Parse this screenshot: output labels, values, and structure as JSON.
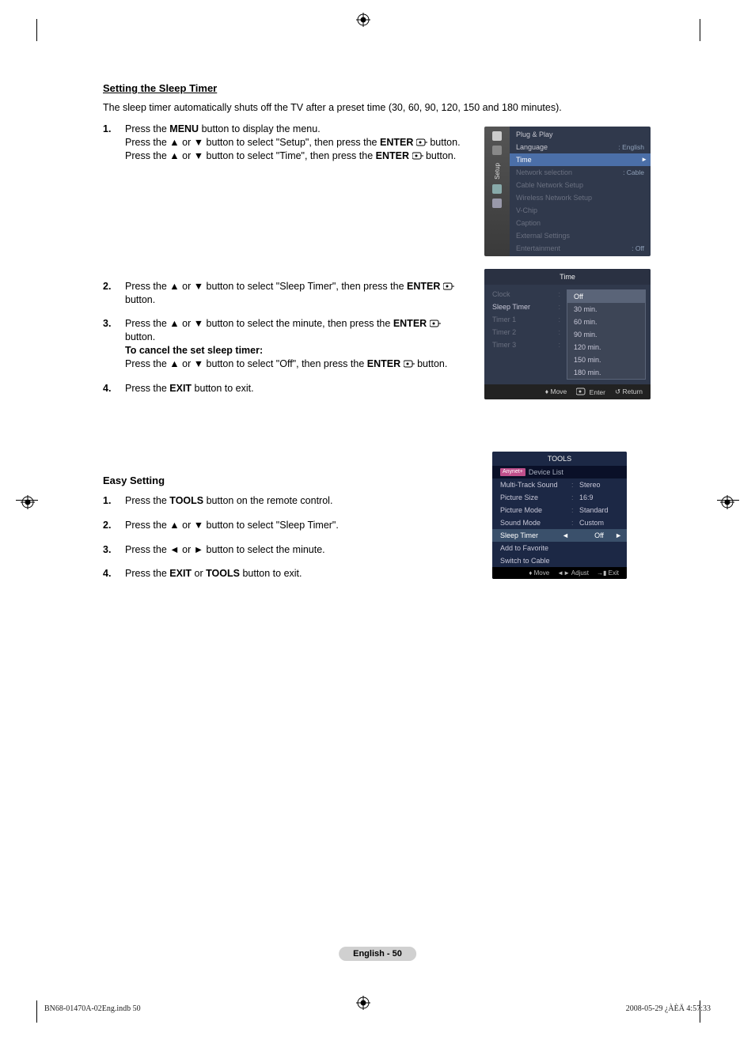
{
  "section1": {
    "title": "Setting the Sleep Timer",
    "intro": "The sleep timer automatically shuts off the TV after a preset time (30, 60, 90, 120, 150 and 180 minutes).",
    "steps": [
      {
        "num": "1.",
        "line1a": "Press the ",
        "line1b": "MENU",
        "line1c": " button to display the menu.",
        "line2a": "Press the ▲ or ▼ button to select \"Setup\", then press the ",
        "line2b": "ENTER",
        "line2c": " button.",
        "line3a": "Press the ▲ or ▼ button to select \"Time\", then press the ",
        "line3b": "ENTER",
        "line3c": " button."
      },
      {
        "num": "2.",
        "line1a": "Press the ▲ or ▼ button to select \"Sleep Timer\", then press the ",
        "line1b": "ENTER",
        "line1c": " button."
      },
      {
        "num": "3.",
        "line1a": "Press the ▲ or ▼ button to select the minute, then press the ",
        "line1b": "ENTER",
        "line1c": " button.",
        "cancel_title": "To cancel the set sleep timer:",
        "cancel_a": "Press the ▲ or ▼ button to select \"Off\", then press the ",
        "cancel_b": "ENTER",
        "cancel_c": " button."
      },
      {
        "num": "4.",
        "line1a": "Press the ",
        "line1b": "EXIT",
        "line1c": " button to exit."
      }
    ]
  },
  "section2": {
    "title": "Easy Setting",
    "steps": [
      {
        "num": "1.",
        "a": "Press the ",
        "b": "TOOLS",
        "c": " button on the remote control."
      },
      {
        "num": "2.",
        "a": "Press the ▲ or ▼ button to select \"Sleep Timer\"."
      },
      {
        "num": "3.",
        "a": "Press the ◄ or ► button to select the minute."
      },
      {
        "num": "4.",
        "a": "Press the ",
        "b": "EXIT",
        "c": " or ",
        "d": "TOOLS",
        "e": " button to exit."
      }
    ]
  },
  "osd_setup": {
    "side_label": "Setup",
    "rows": [
      {
        "label": "Plug & Play",
        "value": ""
      },
      {
        "label": "Language",
        "value": ": English"
      }
    ],
    "selected": "Time",
    "dim_rows": [
      {
        "label": "Network selection",
        "value": ": Cable"
      },
      {
        "label": "Cable Network Setup",
        "value": ""
      },
      {
        "label": "Wireless Network Setup",
        "value": ""
      },
      {
        "label": "V-Chip",
        "value": ""
      },
      {
        "label": "Caption",
        "value": ""
      },
      {
        "label": "External Settings",
        "value": ""
      },
      {
        "label": "Entertainment",
        "value": ": Off"
      }
    ]
  },
  "osd_time": {
    "title": "Time",
    "left": [
      "Clock",
      "Sleep Timer",
      "Timer 1",
      "Timer 2",
      "Timer 3"
    ],
    "options": [
      "Off",
      "30 min.",
      "60 min.",
      "90 min.",
      "120 min.",
      "150 min.",
      "180 min."
    ],
    "footer": {
      "move": "Move",
      "enter": "Enter",
      "return": "Return"
    }
  },
  "osd_tools": {
    "title": "TOOLS",
    "top_tag": "Anynet+",
    "top_label": "Device List",
    "rows": [
      {
        "label": "Multi-Track Sound",
        "value": "Stereo"
      },
      {
        "label": "Picture Size",
        "value": "16:9"
      },
      {
        "label": "Picture Mode",
        "value": "Standard"
      },
      {
        "label": "Sound Mode",
        "value": "Custom"
      }
    ],
    "selected": {
      "label": "Sleep Timer",
      "value": "Off"
    },
    "bottom_rows": [
      "Add to Favorite",
      "Switch to Cable"
    ],
    "footer": {
      "move": "Move",
      "adjust": "Adjust",
      "exit": "Exit"
    }
  },
  "footer_pill": "English - 50",
  "meta": {
    "left": "BN68-01470A-02Eng.indb   50",
    "right": "2008-05-29   ¿ÀÈÄ 4:57:33"
  }
}
